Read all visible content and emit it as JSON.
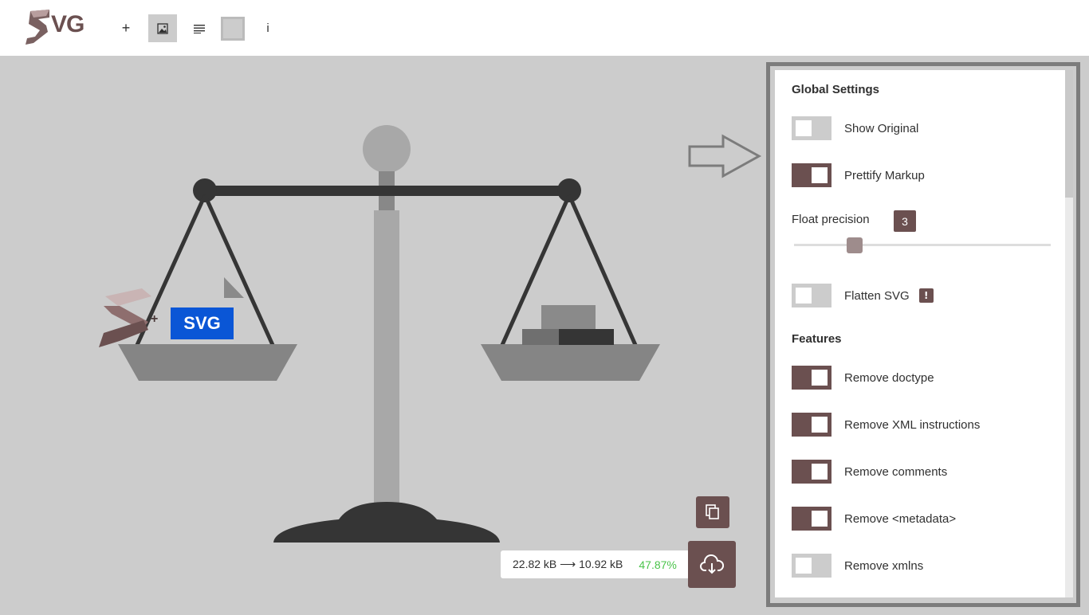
{
  "app": {
    "logo_text": "VG",
    "toolbar": {
      "add_label": "+",
      "markup_label": "≡",
      "info_label": "i"
    }
  },
  "canvas": {
    "badge_text": "SVG",
    "plus_mark": "+"
  },
  "stats": {
    "sizes": "22.82 kB ⟶ 10.92 kB",
    "saving": "47.87%"
  },
  "settings": {
    "global_title": "Global Settings",
    "show_original": {
      "label": "Show Original",
      "on": false
    },
    "prettify": {
      "label": "Prettify Markup",
      "on": true
    },
    "precision": {
      "label": "Float precision",
      "value": "3",
      "level_fraction": 0.24
    },
    "flatten": {
      "label": "Flatten SVG",
      "on": false,
      "warn": "!"
    },
    "features_title": "Features",
    "features": [
      {
        "label": "Remove doctype",
        "on": true
      },
      {
        "label": "Remove XML instructions",
        "on": true
      },
      {
        "label": "Remove comments",
        "on": true
      },
      {
        "label": "Remove <metadata>",
        "on": true
      },
      {
        "label": "Remove xmlns",
        "on": false
      }
    ]
  },
  "colors": {
    "brand": "#6b5050",
    "saving_green": "#4bc44b",
    "canvas_bg": "#cccccc"
  }
}
